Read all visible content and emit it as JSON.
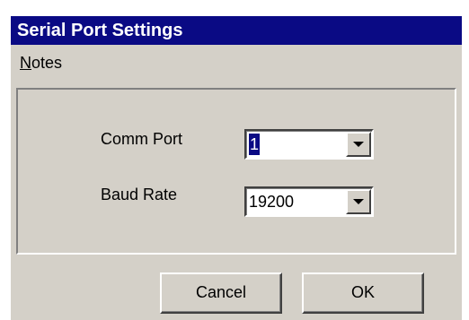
{
  "window": {
    "title": "Serial Port Settings"
  },
  "menu": {
    "items": [
      {
        "mnemonic": "N",
        "rest": "otes"
      }
    ]
  },
  "fields": {
    "comm_port": {
      "label": "Comm Port",
      "value": "1"
    },
    "baud_rate": {
      "label": "Baud Rate",
      "value": "19200"
    }
  },
  "buttons": {
    "cancel": "Cancel",
    "ok": "OK"
  },
  "colors": {
    "titlebar": "#0a0a84",
    "face": "#d4d0c8",
    "title_text": "#ffffff"
  },
  "icons": {
    "dropdown": "chevron-down-icon"
  }
}
